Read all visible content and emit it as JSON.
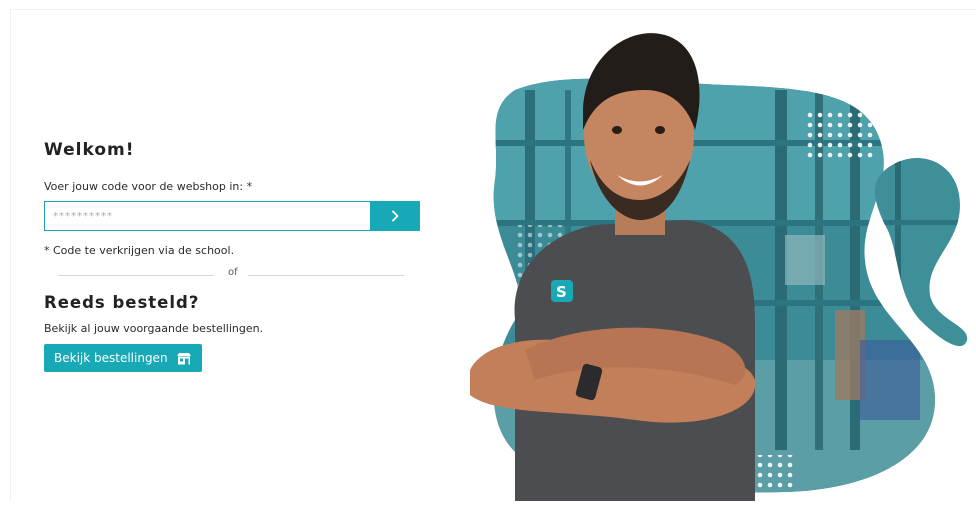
{
  "login": {
    "title": "Welkom!",
    "code_label": "Voer jouw code voor de webshop in: *",
    "code_placeholder": "**********",
    "code_note": "* Code te verkrijgen via de school.",
    "divider": "of"
  },
  "orders": {
    "title": "Reeds besteld?",
    "description": "Bekijk al jouw voorgaande bestellingen.",
    "button_label": "Bekijk bestellingen"
  },
  "hero": {
    "shirt_logo": "S"
  },
  "colors": {
    "accent": "#18a9b7",
    "shirt": "#4b4d50",
    "warehouse": "#2f7f8c"
  },
  "icons": {
    "submit": "chevron-right-icon",
    "orders": "store-icon"
  }
}
